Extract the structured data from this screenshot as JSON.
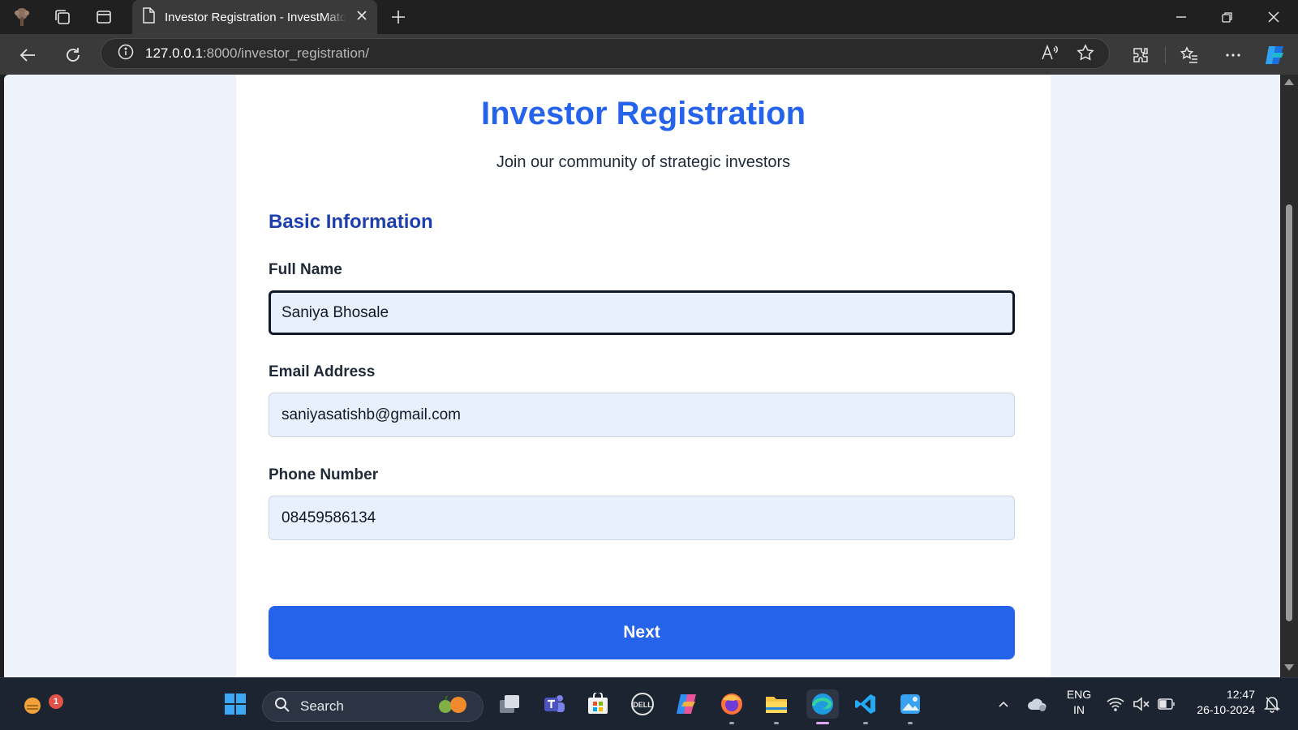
{
  "browser": {
    "tab_title": "Investor Registration - InvestMatch",
    "url_host": "127.0.0.1",
    "url_path": ":8000/investor_registration/"
  },
  "page": {
    "title": "Investor Registration",
    "subtitle": "Join our community of strategic investors",
    "section_title": "Basic Information",
    "fields": [
      {
        "label": "Full Name",
        "value": "Saniya Bhosale",
        "focused": true
      },
      {
        "label": "Email Address",
        "value": "saniyasatishb@gmail.com",
        "focused": false
      },
      {
        "label": "Phone Number",
        "value": "08459586134",
        "focused": false
      }
    ],
    "next_label": "Next",
    "colors": {
      "primary": "#2563eb",
      "section": "#1e40af",
      "input_bg": "#e8effd"
    }
  },
  "taskbar": {
    "search_placeholder": "Search",
    "notification_count": "1",
    "language_line1": "ENG",
    "language_line2": "IN",
    "time": "12:47",
    "date": "26-10-2024",
    "apps": [
      "task-view",
      "teams",
      "store",
      "dell",
      "copilot",
      "firefox",
      "file-explorer",
      "edge",
      "vscode",
      "photos"
    ]
  }
}
